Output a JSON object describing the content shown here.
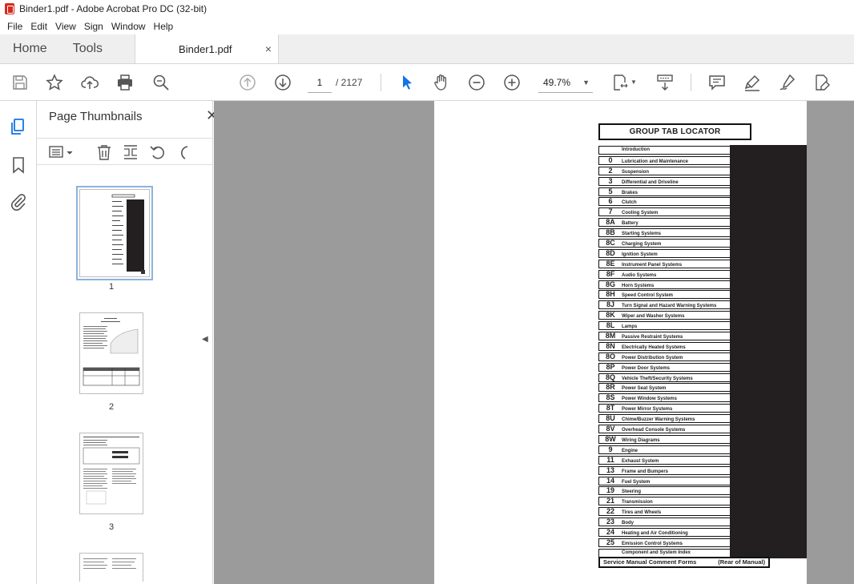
{
  "window": {
    "title": "Binder1.pdf - Adobe Acrobat Pro DC (32-bit)"
  },
  "menu": [
    "File",
    "Edit",
    "View",
    "Sign",
    "Window",
    "Help"
  ],
  "tabs": {
    "home": "Home",
    "tools": "Tools",
    "document": "Binder1.pdf",
    "close": "×"
  },
  "toolbar": {
    "page_current": "1",
    "page_total": "/  2127",
    "zoom": "49.7%"
  },
  "panel": {
    "title": "Page Thumbnails",
    "close": "✕",
    "thumbnails": [
      {
        "label": "1",
        "selected": true
      },
      {
        "label": "2",
        "selected": false
      },
      {
        "label": "3",
        "selected": false
      }
    ]
  },
  "document": {
    "locator_title": "GROUP TAB LOCATOR",
    "rows": [
      {
        "num": "",
        "label": "Introduction"
      },
      {
        "num": "0",
        "label": "Lubrication and Maintenance"
      },
      {
        "num": "2",
        "label": "Suspension"
      },
      {
        "num": "3",
        "label": "Differential and Driveline"
      },
      {
        "num": "5",
        "label": "Brakes"
      },
      {
        "num": "6",
        "label": "Clutch"
      },
      {
        "num": "7",
        "label": "Cooling System"
      },
      {
        "num": "8A",
        "label": "Battery"
      },
      {
        "num": "8B",
        "label": "Starting Systems"
      },
      {
        "num": "8C",
        "label": "Charging System"
      },
      {
        "num": "8D",
        "label": "Ignition System"
      },
      {
        "num": "8E",
        "label": "Instrument Panel Systems"
      },
      {
        "num": "8F",
        "label": "Audio Systems"
      },
      {
        "num": "8G",
        "label": "Horn Systems"
      },
      {
        "num": "8H",
        "label": "Speed Control System"
      },
      {
        "num": "8J",
        "label": "Turn Signal and Hazard Warning Systems"
      },
      {
        "num": "8K",
        "label": "Wiper and Washer Systems"
      },
      {
        "num": "8L",
        "label": "Lamps"
      },
      {
        "num": "8M",
        "label": "Passive Restraint Systems"
      },
      {
        "num": "8N",
        "label": "Electrically Heated Systems"
      },
      {
        "num": "8O",
        "label": "Power Distribution System"
      },
      {
        "num": "8P",
        "label": "Power Door Systems"
      },
      {
        "num": "8Q",
        "label": "Vehicle Theft/Security Systems"
      },
      {
        "num": "8R",
        "label": "Power Seat System"
      },
      {
        "num": "8S",
        "label": "Power Window Systems"
      },
      {
        "num": "8T",
        "label": "Power Mirror Systems"
      },
      {
        "num": "8U",
        "label": "Chime/Buzzer Warning Systems"
      },
      {
        "num": "8V",
        "label": "Overhead Console Systems"
      },
      {
        "num": "8W",
        "label": "Wiring Diagrams"
      },
      {
        "num": "9",
        "label": "Engine"
      },
      {
        "num": "11",
        "label": "Exhaust System"
      },
      {
        "num": "13",
        "label": "Frame and Bumpers"
      },
      {
        "num": "14",
        "label": "Fuel System"
      },
      {
        "num": "19",
        "label": "Steering"
      },
      {
        "num": "21",
        "label": "Transmission"
      },
      {
        "num": "22",
        "label": "Tires and Wheels"
      },
      {
        "num": "23",
        "label": "Body"
      },
      {
        "num": "24",
        "label": "Heating and Air Conditioning"
      },
      {
        "num": "25",
        "label": "Emission Control Systems"
      },
      {
        "num": "",
        "label": "Component and System Index"
      }
    ],
    "footer_left": "Service Manual Comment Forms",
    "footer_right": "(Rear of Manual)"
  },
  "colors": {
    "accent": "#1473e6",
    "viewer_bg": "#9b9b9b",
    "tab_bar": "#231f20"
  }
}
